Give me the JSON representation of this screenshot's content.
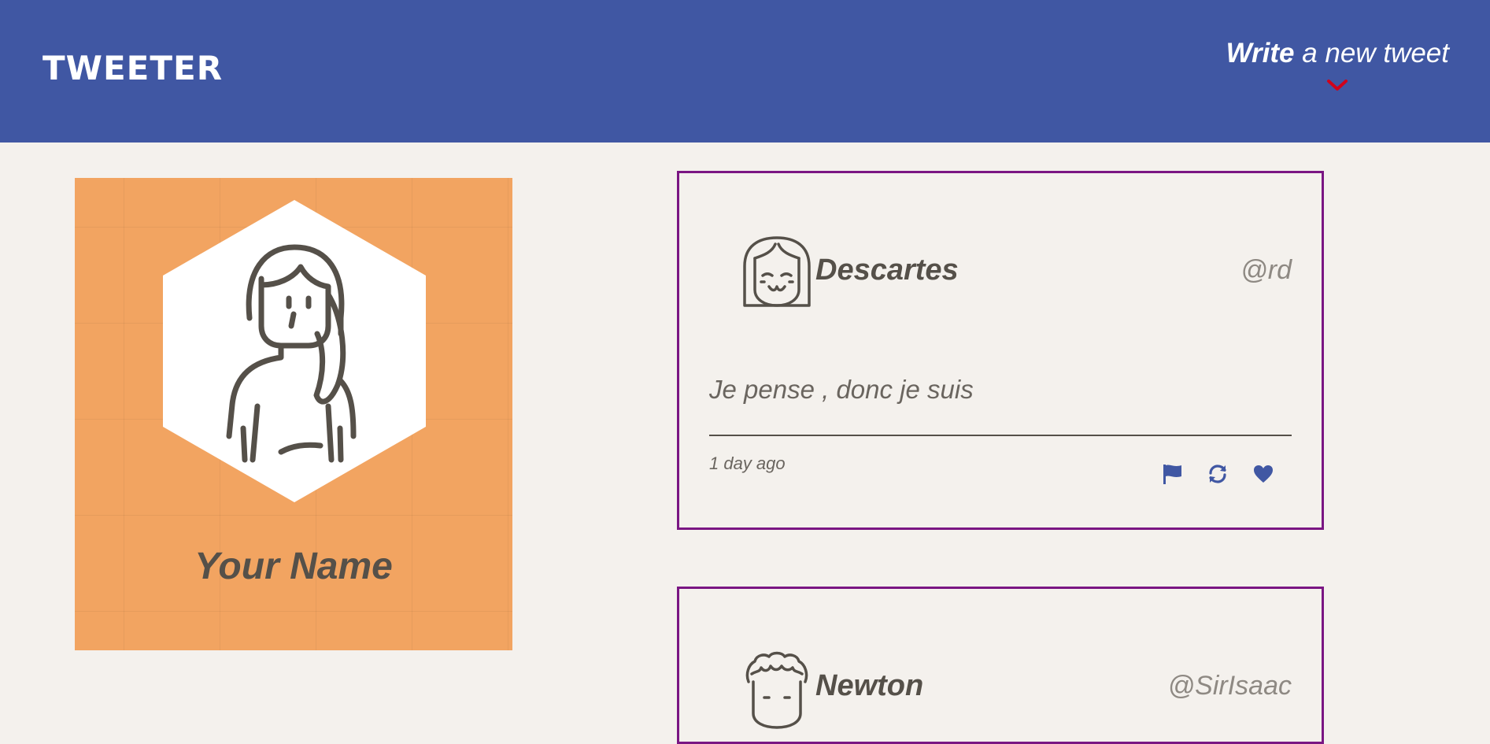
{
  "navbar": {
    "logo": "TWEETER",
    "compose_bold": "Write",
    "compose_rest": " a new tweet",
    "colors": {
      "background": "#4057a3",
      "chevron": "#d0021b"
    }
  },
  "profile": {
    "name": "Your Name",
    "colors": {
      "background": "#f2a461"
    }
  },
  "tweets": [
    {
      "name": "Descartes",
      "handle": "@rd",
      "content": "Je pense , donc je suis",
      "time": "1 day ago",
      "actions": [
        "flag-icon",
        "retweet-icon",
        "heart-icon"
      ]
    },
    {
      "name": "Newton",
      "handle": "@SirIsaac"
    }
  ],
  "colors": {
    "page_background": "#f4f1ed",
    "tweet_border": "#7a1683",
    "action_icons": "#4057a3",
    "text_dark": "#555049"
  }
}
